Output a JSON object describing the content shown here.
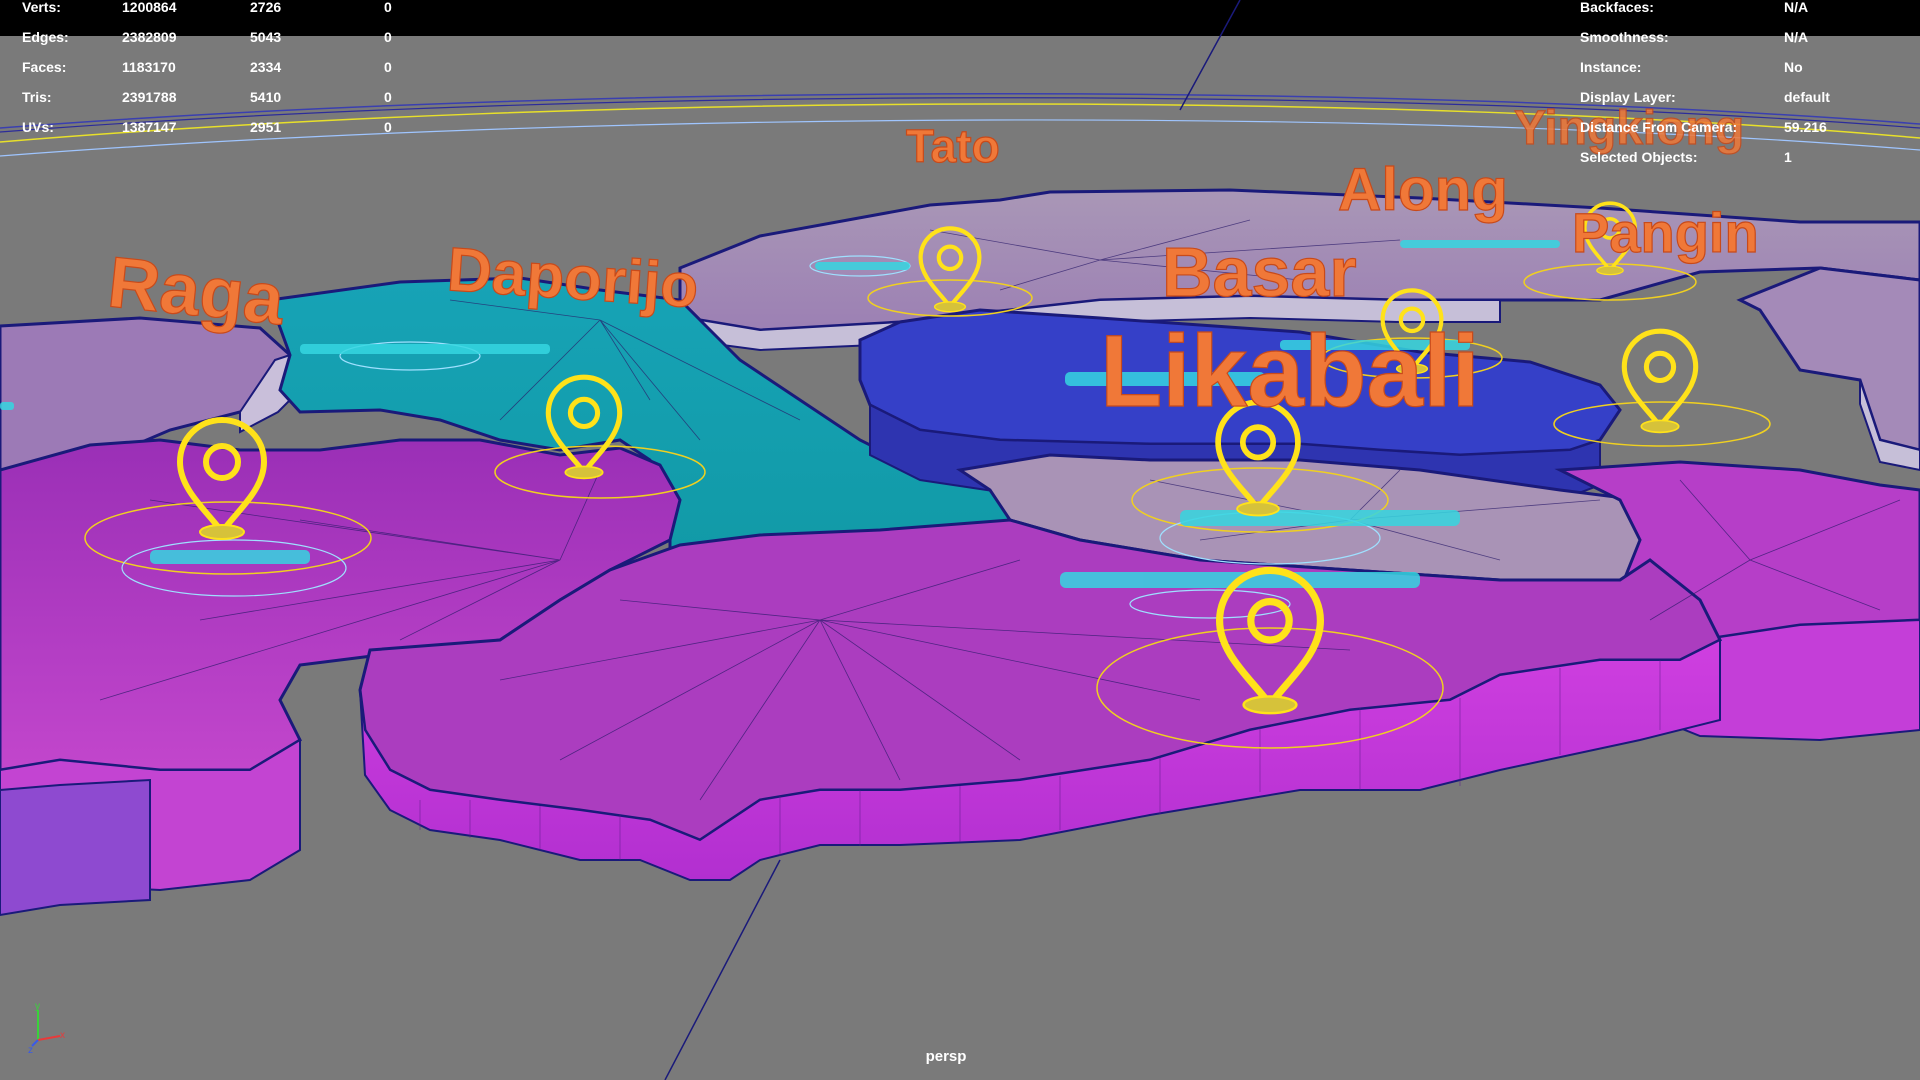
{
  "viewport": {
    "camera": "persp"
  },
  "hud": {
    "stats": [
      {
        "label": "Verts:",
        "values": [
          "1200864",
          "2726",
          "0"
        ]
      },
      {
        "label": "Edges:",
        "values": [
          "2382809",
          "5043",
          "0"
        ]
      },
      {
        "label": "Faces:",
        "values": [
          "1183170",
          "2334",
          "0"
        ]
      },
      {
        "label": "Tris:",
        "values": [
          "2391788",
          "5410",
          "0"
        ]
      },
      {
        "label": "UVs:",
        "values": [
          "1387147",
          "2951",
          "0"
        ]
      }
    ],
    "object_info": [
      {
        "label": "Backfaces:",
        "value": "N/A"
      },
      {
        "label": "Smoothness:",
        "value": "N/A"
      },
      {
        "label": "Instance:",
        "value": "No"
      },
      {
        "label": "Display Layer:",
        "value": "default"
      },
      {
        "label": "Distance From Camera:",
        "value": "59.216"
      },
      {
        "label": "Selected Objects:",
        "value": "1"
      }
    ]
  },
  "map": {
    "place_labels": [
      "Tato",
      "Yingkiong",
      "Along",
      "Raga",
      "Daporijo",
      "Basar",
      "Pangin",
      "Likabali"
    ],
    "colors": {
      "background": "#7a7a7a",
      "magenta_region": "#b43ec8",
      "teal_region": "#1aa3b0",
      "blue_region": "#3a3fd0",
      "lavender_region": "#a48ab8",
      "label_text": "#f07838",
      "pin": "#ffe21a",
      "wireframe": "#1a1a7a"
    }
  }
}
